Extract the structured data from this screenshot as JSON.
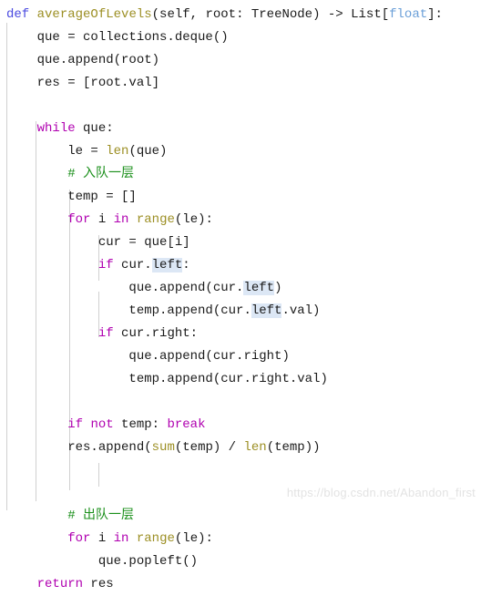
{
  "editor": {
    "language": "Python",
    "theme_background": "#ffffff",
    "font_size_px": 14,
    "line_height_px": 25,
    "colors": {
      "keyword": "#b000b0",
      "def_keyword": "#4a4ae0",
      "function_name": "#9c8f24",
      "builtin_function": "#9c8f24",
      "type_name": "#1a1a1a",
      "soft_type": "#6a9fd8",
      "comment": "#1a8f1a",
      "default_text": "#1a1a1a",
      "occurrence_highlight": "#dce7f5",
      "indent_guide": "#d0d0d0",
      "watermark": "#e3e3e3"
    },
    "indent_guides_x": [
      7,
      39,
      76,
      108
    ],
    "occurrence_highlight_token": "left"
  },
  "code": {
    "full_text": "def averageOfLevels(self, root: TreeNode) -> List[float]:\n    que = collections.deque()\n    que.append(root)\n    res = [root.val]\n\n    while que:\n        le = len(que)\n        # 入队一层\n        temp = []\n        for i in range(le):\n            cur = que[i]\n            if cur.left:\n                que.append(cur.left)\n                temp.append(cur.left.val)\n            if cur.right:\n                que.append(cur.right)\n                temp.append(cur.right.val)\n\n        if not temp: break\n        res.append(sum(temp) / len(temp))\n\n\n        # 出队一层\n        for i in range(le):\n            que.popleft()\n    return res",
    "lines": [
      "def averageOfLevels(self, root: TreeNode) -> List[float]:",
      "    que = collections.deque()",
      "    que.append(root)",
      "    res = [root.val]",
      "",
      "    while que:",
      "        le = len(que)",
      "        # 入队一层",
      "        temp = []",
      "        for i in range(le):",
      "            cur = que[i]",
      "            if cur.left:",
      "                que.append(cur.left)",
      "                temp.append(cur.left.val)",
      "            if cur.right:",
      "                que.append(cur.right)",
      "                temp.append(cur.right.val)",
      "",
      "        if not temp: break",
      "        res.append(sum(temp) / len(temp))",
      "",
      "",
      "        # 出队一层",
      "        for i in range(le):",
      "            que.popleft()",
      "    return res"
    ],
    "comments": [
      "# 入队一层",
      "# 出队一层"
    ],
    "keywords_used": [
      "def",
      "while",
      "for",
      "in",
      "if",
      "not",
      "break",
      "return"
    ],
    "builtins_used": [
      "len",
      "range",
      "sum"
    ],
    "identifiers": [
      "averageOfLevels",
      "self",
      "root",
      "TreeNode",
      "List",
      "float",
      "que",
      "collections",
      "deque",
      "append",
      "res",
      "val",
      "le",
      "temp",
      "i",
      "cur",
      "left",
      "right",
      "popleft"
    ]
  },
  "watermark": {
    "text": "https://blog.csdn.net/Abandon_first"
  }
}
